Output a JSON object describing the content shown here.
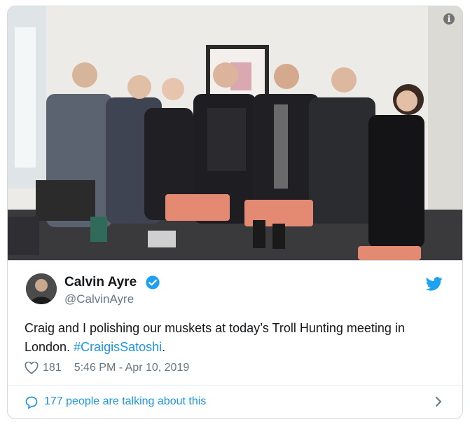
{
  "tweet": {
    "author_name": "Calvin Ayre",
    "author_handle": "@CalvinAyre",
    "text_main": "Craig and I polishing our muskets at today’s Troll Hunting meeting in London.",
    "hashtag": "#CraigisSatoshi",
    "text_end": ".",
    "likes": "181",
    "timestamp": "5:46 PM - Apr 10, 2019",
    "conversation": "177 people are talking about this"
  },
  "media": {
    "info_glyph": "i"
  },
  "icons": {
    "verified": "verified-badge-icon",
    "brand": "twitter-bird-icon",
    "like": "heart-icon",
    "conversation": "speech-bubble-icon",
    "chevron": "chevron-right-icon",
    "info": "info-icon"
  },
  "colors": {
    "link": "#1b95e0",
    "secondary_text": "#657786",
    "border": "#cfd9de"
  }
}
